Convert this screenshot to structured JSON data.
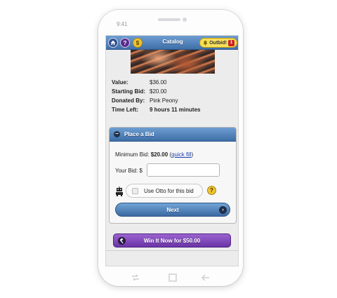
{
  "device": {
    "time": "9:41"
  },
  "header": {
    "home_icon": "home-icon",
    "help_label": "?",
    "coin_label": "$",
    "title": "Catalog",
    "outbid_label": "Outbid!",
    "outbid_count": "1"
  },
  "item": {
    "photo": "item-photo",
    "details": [
      {
        "label": "Value:",
        "value": "$36.00"
      },
      {
        "label": "Starting Bid:",
        "value": "$20.00"
      },
      {
        "label": "Donated By:",
        "value": "Pink Peony"
      },
      {
        "label": "Time Left:",
        "value": "9 hours 11 minutes"
      }
    ]
  },
  "bid_panel": {
    "collapse_symbol": "−",
    "title": "Place a Bid",
    "min_bid_label": "Minimum Bid:",
    "min_bid_value": "$20.00",
    "quick_fill_label": "quick fill",
    "your_bid_label": "Your Bid: $",
    "your_bid_value": "",
    "your_bid_placeholder": "",
    "otto_label": "Use Otto for this bid",
    "otto_checked": false,
    "otto_help": "?",
    "next_label": "Next",
    "next_chevron": "›"
  },
  "win_button": {
    "label": "Win It Now for $50.00",
    "icon": "hammer-icon"
  },
  "colors": {
    "header_blue": "#4f80b9",
    "outbid_yellow": "#f7e05b",
    "win_purple": "#7b45b8",
    "link_blue": "#1c3fb0"
  }
}
